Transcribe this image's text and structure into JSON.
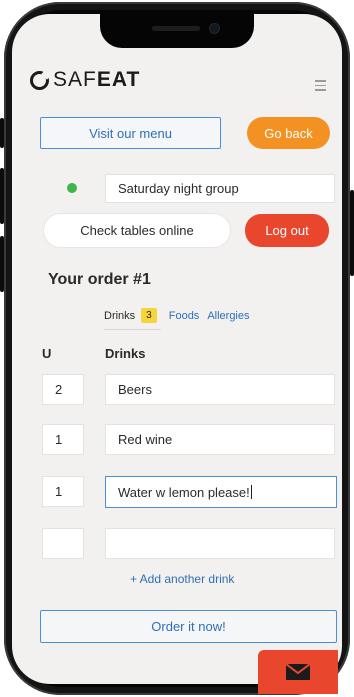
{
  "brand": {
    "part1": "SAF",
    "part2": "EAT"
  },
  "header": {
    "visit_menu_label": "Visit our menu",
    "go_back_label": "Go back"
  },
  "group": {
    "name_value": "Saturday night group",
    "status_color": "#3fb44d"
  },
  "actions": {
    "check_tables_label": "Check tables online",
    "logout_label": "Log out"
  },
  "order": {
    "title": "Your order #1",
    "tabs": {
      "drinks_label": "Drinks",
      "drinks_count": "3",
      "foods_label": "Foods",
      "allergies_label": "Allergies"
    },
    "columns": {
      "qty_header": "U",
      "item_header": "Drinks"
    },
    "rows": [
      {
        "qty": "2",
        "item": "Beers"
      },
      {
        "qty": "1",
        "item": "Red wine"
      },
      {
        "qty": "1",
        "item": "Water w lemon please!"
      },
      {
        "qty": "",
        "item": ""
      }
    ],
    "add_another_label": "+ Add another drink",
    "submit_label": "Order it now!"
  },
  "colors": {
    "accent_blue": "#4a8fd6",
    "orange": "#f39222",
    "red_orange": "#e8472e",
    "badge_yellow": "#f7d43a"
  },
  "icons": [
    "menu-icon",
    "mail-icon",
    "safeat-logo"
  ]
}
